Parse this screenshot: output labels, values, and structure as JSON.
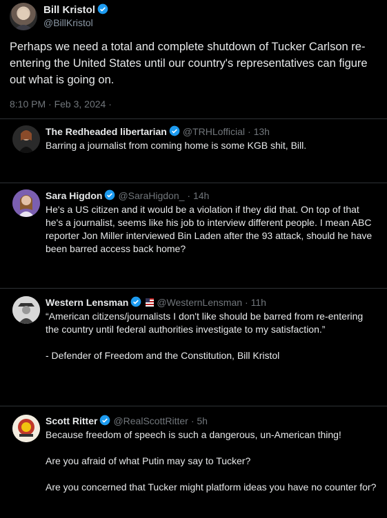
{
  "main": {
    "name": "Bill Kristol",
    "handle": "@BillKristol",
    "text": "Perhaps we need a total and complete shutdown of Tucker Carlson re-entering the United States until our country's representatives can figure out what is going on.",
    "timestamp": "8:10 PM · Feb 3, 2024 ·"
  },
  "replies": [
    {
      "name": "The Redheaded libertarian",
      "handle": "@TRHLofficial",
      "time": "· 13h",
      "lines": [
        "Barring a journalist from coming home is some KGB shit, Bill."
      ]
    },
    {
      "name": "Sara Higdon",
      "handle": "@SaraHigdon_",
      "time": "· 14h",
      "lines": [
        "He's a US citizen and it would be a violation if they did that. On top of that he's a journalist, seems like his job to interview different people. I mean ABC reporter Jon Miller interviewed Bin Laden after the 93 attack, should he have been barred access back home?"
      ]
    },
    {
      "name": "Western Lensman",
      "handle": "@WesternLensman",
      "time": "· 11h",
      "lines": [
        "“American citizens/journalists I don't like should be barred from re-entering the country until federal authorities investigate to my satisfaction.”",
        "- Defender of Freedom and the Constitution, Bill Kristol"
      ]
    },
    {
      "name": "Scott Ritter",
      "handle": "@RealScottRitter",
      "time": "· 5h",
      "lines": [
        "Because freedom of speech is such a dangerous, un-American thing!",
        "Are you afraid of what Putin may say to Tucker?",
        "Are you concerned that Tucker might platform ideas you have no counter for?"
      ]
    }
  ],
  "colors": {
    "background": "#000000",
    "text": "#e7e9ea",
    "muted": "#71767b",
    "verified": "#1d9bf0",
    "divider": "#2f3336"
  }
}
